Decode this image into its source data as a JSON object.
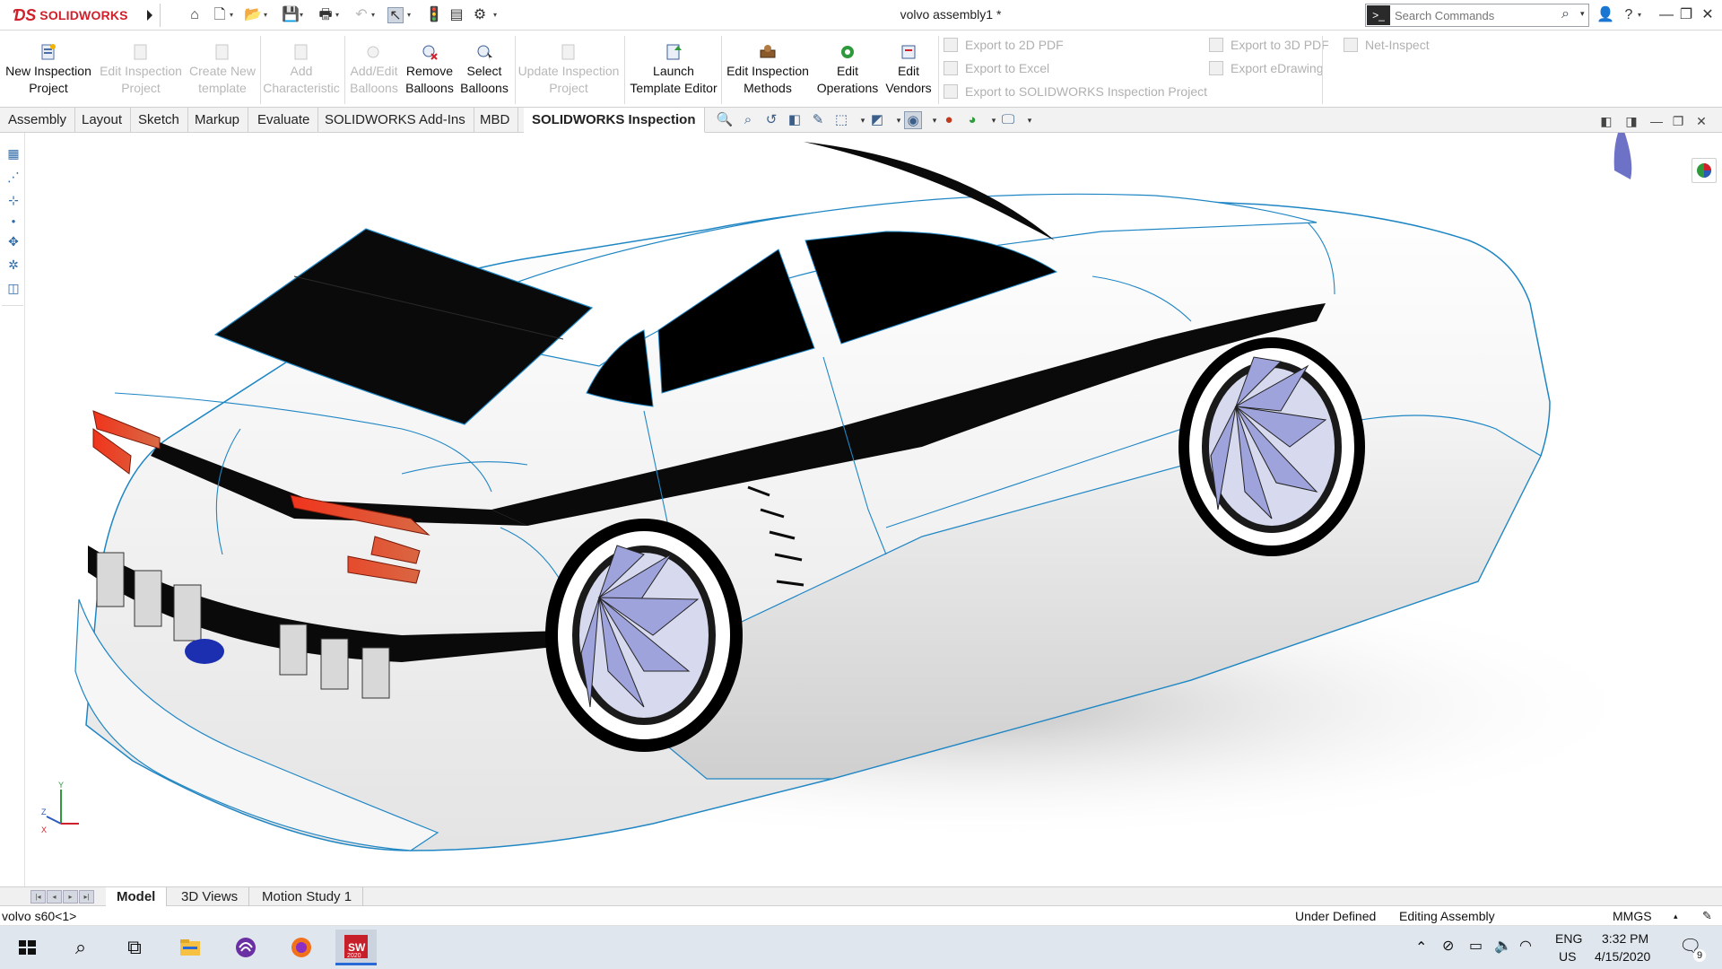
{
  "window": {
    "title": "volvo assembly1 *",
    "brand": "SOLIDWORKS"
  },
  "search": {
    "placeholder": "Search Commands"
  },
  "ribbon": {
    "buttons": [
      {
        "label1": "New Inspection",
        "label2": "Project",
        "enabled": true,
        "icon": "new-inspection-project-icon"
      },
      {
        "label1": "Edit Inspection",
        "label2": "Project",
        "enabled": false,
        "icon": "edit-inspection-project-icon"
      },
      {
        "label1": "Create New",
        "label2": "template",
        "enabled": false,
        "icon": "create-template-icon"
      },
      {
        "label1": "Add",
        "label2": "Characteristic",
        "enabled": false,
        "icon": "add-characteristic-icon"
      },
      {
        "label1": "Add/Edit",
        "label2": "Balloons",
        "enabled": false,
        "icon": "add-edit-balloons-icon"
      },
      {
        "label1": "Remove",
        "label2": "Balloons",
        "enabled": true,
        "icon": "remove-balloons-icon"
      },
      {
        "label1": "Select",
        "label2": "Balloons",
        "enabled": true,
        "icon": "select-balloons-icon"
      },
      {
        "label1": "Update Inspection",
        "label2": "Project",
        "enabled": false,
        "icon": "update-inspection-project-icon"
      },
      {
        "label1": "Launch",
        "label2": "Template Editor",
        "enabled": true,
        "icon": "launch-template-editor-icon"
      },
      {
        "label1": "Edit Inspection",
        "label2": "Methods",
        "enabled": true,
        "icon": "edit-inspection-methods-icon"
      },
      {
        "label1": "Edit",
        "label2": "Operations",
        "enabled": true,
        "icon": "edit-operations-icon"
      },
      {
        "label1": "Edit",
        "label2": "Vendors",
        "enabled": true,
        "icon": "edit-vendors-icon"
      }
    ],
    "exports": {
      "pdf2d": "Export to 2D PDF",
      "excel": "Export to Excel",
      "sw_inspection": "Export to SOLIDWORKS Inspection Project",
      "pdf3d": "Export to 3D PDF",
      "edrawing": "Export eDrawing",
      "net_inspect": "Net-Inspect"
    }
  },
  "tabs": [
    "Assembly",
    "Layout",
    "Sketch",
    "Markup",
    "Evaluate",
    "SOLIDWORKS Add-Ins",
    "MBD",
    "SOLIDWORKS Inspection"
  ],
  "active_tab": "SOLIDWORKS Inspection",
  "bottom_tabs": [
    "Model",
    "3D Views",
    "Motion Study 1"
  ],
  "active_bottom_tab": "Model",
  "status": {
    "component": "volvo s60<1>",
    "definition": "Under Defined",
    "mode": "Editing Assembly",
    "units": "MMGS"
  },
  "taskbar": {
    "lang1": "ENG",
    "lang2": "US",
    "time": "3:32 PM",
    "date": "4/15/2020",
    "notifications": "9",
    "sw_badge": "2020"
  },
  "triad": {
    "x": "X",
    "y": "Y",
    "z": "Z"
  },
  "colors": {
    "brand_red": "#d0202b",
    "edge_blue": "#1f86c4",
    "wheel_spoke": "#b9bde8",
    "taillight": "#e8321e"
  }
}
